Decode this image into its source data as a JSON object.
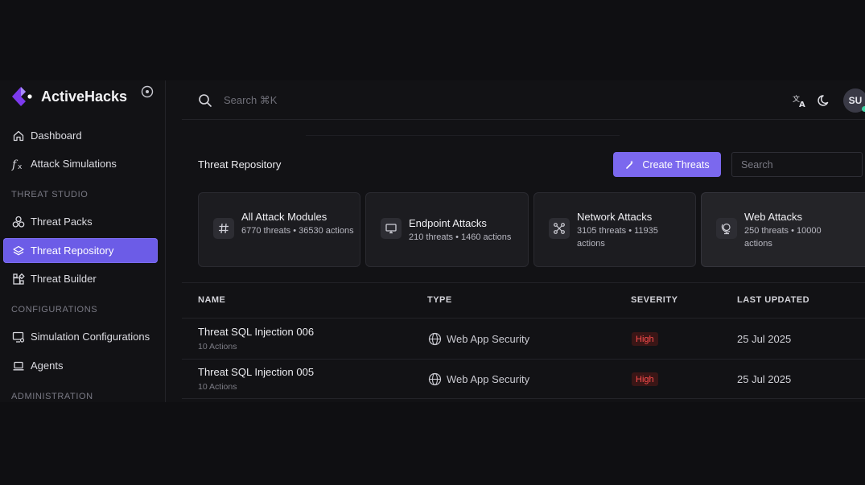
{
  "brand": {
    "name": "ActiveHacks",
    "logo_color": "#7c3aed"
  },
  "sidebar": {
    "items": [
      {
        "label": "Dashboard",
        "icon": "home-icon"
      },
      {
        "label": "Attack Simulations",
        "icon": "function-icon"
      }
    ],
    "sections": [
      {
        "title": "THREAT STUDIO",
        "items": [
          {
            "label": "Threat Packs",
            "icon": "packs-icon"
          },
          {
            "label": "Threat Repository",
            "icon": "layers-icon",
            "active": true
          },
          {
            "label": "Threat Builder",
            "icon": "blocks-icon"
          }
        ]
      },
      {
        "title": "CONFIGURATIONS",
        "items": [
          {
            "label": "Simulation Configurations",
            "icon": "monitor-settings-icon"
          },
          {
            "label": "Agents",
            "icon": "laptop-icon"
          }
        ]
      },
      {
        "title": "ADMINISTRATION",
        "items": []
      }
    ]
  },
  "topbar": {
    "search_placeholder": "Search ⌘K",
    "avatar_initials": "SU",
    "icons": [
      "translate-icon",
      "moon-icon"
    ]
  },
  "main": {
    "title": "Threat Repository",
    "create_button": "Create Threats",
    "search_placeholder": "Search",
    "cards": [
      {
        "title": "All Attack Modules",
        "desc": "6770 threats • 36530 actions",
        "icon": "hash-icon"
      },
      {
        "title": "Endpoint Attacks",
        "desc": "210 threats • 1460 actions",
        "icon": "monitor-icon"
      },
      {
        "title": "Network Attacks",
        "desc": "3105 threats • 11935 actions",
        "icon": "network-icon"
      },
      {
        "title": "Web Attacks",
        "desc": "250 threats • 10000 actions",
        "icon": "globe-stand-icon"
      }
    ],
    "table": {
      "columns": [
        "NAME",
        "TYPE",
        "SEVERITY",
        "LAST UPDATED"
      ],
      "rows": [
        {
          "name": "Threat SQL Injection 006",
          "sub": "10 Actions",
          "type": "Web App Security",
          "severity": "High",
          "updated": "25 Jul 2025"
        },
        {
          "name": "Threat SQL Injection 005",
          "sub": "10 Actions",
          "type": "Web App Security",
          "severity": "High",
          "updated": "25 Jul 2025"
        }
      ]
    }
  },
  "colors": {
    "accent": "#7b68ee",
    "active_nav": "#6c5ce7",
    "severity_high": "#ff4d4d",
    "online": "#3ed3a3"
  }
}
